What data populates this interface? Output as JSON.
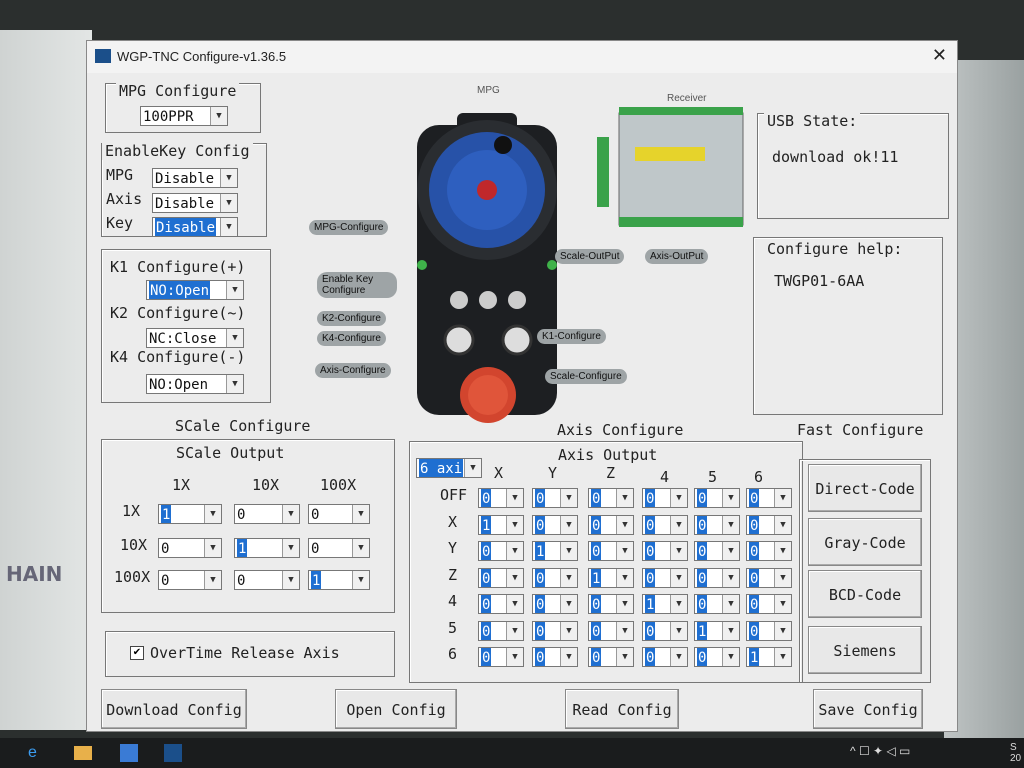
{
  "window": {
    "title": "WGP-TNC Configure-v1.36.5"
  },
  "background": {
    "side_text": "HAIN"
  },
  "mpg_configure": {
    "label": "MPG Configure",
    "value": "100PPR"
  },
  "enablekey": {
    "label": "EnableKey Config",
    "rows": [
      {
        "label": "MPG",
        "value": "Disable"
      },
      {
        "label": "Axis",
        "value": "Disable"
      },
      {
        "label": "Key",
        "value": "Disable"
      }
    ]
  },
  "k_config": {
    "k1_label": "K1 Configure(+)",
    "k1_value": "NO:Open",
    "k2_label": "K2 Configure(~)",
    "k2_value": "NC:Close",
    "k4_label": "K4 Configure(-)",
    "k4_value": "NO:Open"
  },
  "image_labels": {
    "mpg_title": "MPG",
    "receiver_title": "Receiver",
    "mpg_configure": "MPG-Configure",
    "enable_key": "Enable Key Configure",
    "k2": "K2-Configure",
    "k4": "K4-Configure",
    "k1": "K1-Configure",
    "axis": "Axis-Configure",
    "scale": "Scale-Configure",
    "scale_output": "Scale-OutPut",
    "axis_output": "Axis-OutPut"
  },
  "usb_state": {
    "label": "USB State:",
    "value": "download ok!11"
  },
  "configure_help": {
    "label": "Configure help:",
    "value": "TWGP01-6AA"
  },
  "scale_configure": {
    "title": "SCale Configure",
    "output_label": "SCale Output",
    "columns": [
      "1X",
      "10X",
      "100X"
    ],
    "rows": [
      {
        "label": "1X",
        "values": [
          "1",
          "0",
          "0"
        ]
      },
      {
        "label": "10X",
        "values": [
          "0",
          "1",
          "0"
        ]
      },
      {
        "label": "100X",
        "values": [
          "0",
          "0",
          "1"
        ]
      }
    ]
  },
  "axis_configure": {
    "title": "Axis Configure",
    "output_label": "Axis Output",
    "axis_count": "6 axi",
    "columns": [
      "X",
      "Y",
      "Z",
      "4",
      "5",
      "6"
    ],
    "rows": [
      {
        "label": "OFF",
        "values": [
          "0",
          "0",
          "0",
          "0",
          "0",
          "0"
        ]
      },
      {
        "label": "X",
        "values": [
          "1",
          "0",
          "0",
          "0",
          "0",
          "0"
        ]
      },
      {
        "label": "Y",
        "values": [
          "0",
          "1",
          "0",
          "0",
          "0",
          "0"
        ]
      },
      {
        "label": "Z",
        "values": [
          "0",
          "0",
          "1",
          "0",
          "0",
          "0"
        ]
      },
      {
        "label": "4",
        "values": [
          "0",
          "0",
          "0",
          "1",
          "0",
          "0"
        ]
      },
      {
        "label": "5",
        "values": [
          "0",
          "0",
          "0",
          "0",
          "1",
          "0"
        ]
      },
      {
        "label": "6",
        "values": [
          "0",
          "0",
          "0",
          "0",
          "0",
          "1"
        ]
      }
    ]
  },
  "fast_configure": {
    "title": "Fast Configure",
    "buttons": [
      "Direct-Code",
      "Gray-Code",
      "BCD-Code",
      "Siemens"
    ]
  },
  "overtime": {
    "label": "OverTime Release Axis",
    "checked": "✔"
  },
  "footer": {
    "download": "Download Config",
    "open": "Open Config",
    "read": "Read Config",
    "save": "Save Config"
  },
  "taskbar": {
    "corner": "S\n20"
  }
}
